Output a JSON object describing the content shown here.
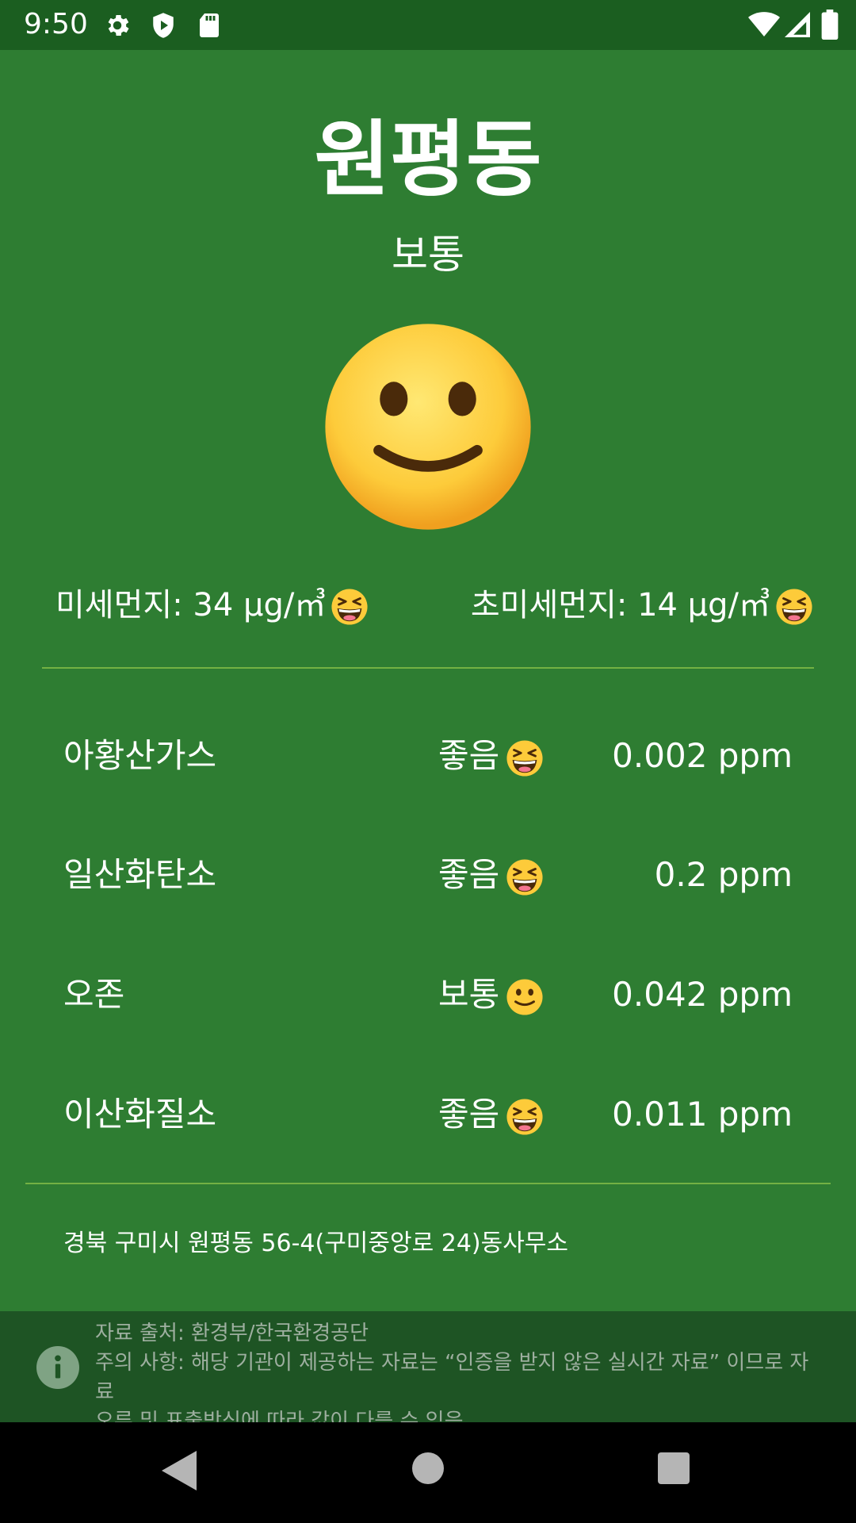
{
  "status_bar": {
    "time": "9:50",
    "left_icons": [
      "gear-icon",
      "shield-play-icon",
      "sd-card-icon"
    ],
    "right_icons": [
      "wifi-icon",
      "signal-icon",
      "battery-icon"
    ]
  },
  "location": {
    "name": "원평동",
    "overall_grade": "보통",
    "overall_emoji": "slightly-smiling-face"
  },
  "dust": {
    "pm10_label": "미세먼지: 34 µg/㎥",
    "pm10_emoji": "grinning-squinting-face",
    "pm25_label": "초미세먼지: 14 µg/㎥",
    "pm25_emoji": "grinning-squinting-face"
  },
  "gases": [
    {
      "name": "아황산가스",
      "grade": "좋음",
      "emoji": "grinning-squinting-face",
      "value": "0.002 ppm"
    },
    {
      "name": "일산화탄소",
      "grade": "좋음",
      "emoji": "grinning-squinting-face",
      "value": "0.2 ppm"
    },
    {
      "name": "오존",
      "grade": "보통",
      "emoji": "slightly-smiling-face",
      "value": "0.042 ppm"
    },
    {
      "name": "이산화질소",
      "grade": "좋음",
      "emoji": "grinning-squinting-face",
      "value": "0.011 ppm"
    }
  ],
  "station": "경북 구미시 원평동 56-4(구미중앙로 24)동사무소",
  "notice": {
    "source": "자료 출처: 환경부/한국환경공단",
    "warning_line1": "주의 사항: 해당 기관이 제공하는 자료는 “인증을 받지 않은 실시간 자료” 이므로 자료",
    "warning_line2": "오류 및 표출방식에 따라 값이 다를 수 있음"
  },
  "colors": {
    "background": "#2E7D32",
    "status_bar": "#1B5E20",
    "notice_bar": "#1E5424",
    "divider": "#8BC34A"
  }
}
